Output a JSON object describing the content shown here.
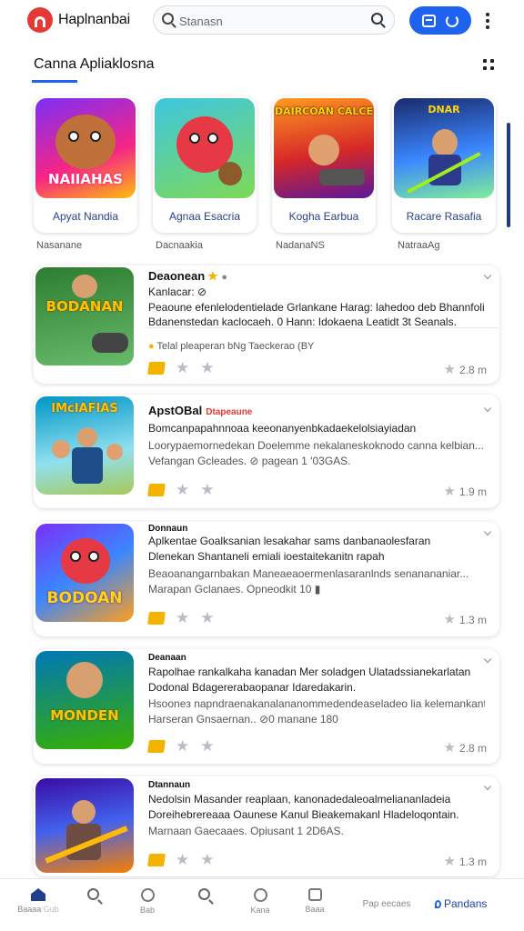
{
  "header": {
    "app_name": "Haplnanbai",
    "search_placeholder": "Stanasn"
  },
  "section": {
    "title": "Canna Apliaklosna"
  },
  "featured": [
    {
      "title": "Apyat Nandia",
      "subtitle": "Nasanane",
      "art_label": "NAIIAHAS"
    },
    {
      "title": "Agnaa Esacria",
      "subtitle": "Dacnaakia",
      "art_label": ""
    },
    {
      "title": "Kogha Earbua",
      "subtitle": "NadanaNS",
      "art_label": "DAIRCOAN CALCE"
    },
    {
      "title": "Racare Rasafia",
      "subtitle": "NatraaAg",
      "art_label": "DNAR"
    }
  ],
  "list": [
    {
      "title": "Deaonean",
      "badge": "",
      "lines": [
        "Kanlacar: ⊘",
        "Peaoune efenlelodentielade Grlankane Harag: lahedoo deb Bhannfolican",
        "Bdanenstedan kaclocaeh. 0 Hann: Idokaena Leatidt 3t Seanals."
      ],
      "note": "Telal pleaperan bNg Taeckerao (BY",
      "rating": "2.8 m",
      "art_label": "BODANAN"
    },
    {
      "title": "ApstOBal",
      "badge": "Dtapeaune",
      "lines": [
        "Bomcanpapahnnoaa keeonanyenbkadaekelolsiayiadan",
        "Loorypaemornedekan Doelemme nekalaneskoknodo canna kelbian...",
        "Vefangan Gcleades.   ⊘ pagean 1 '03GAS."
      ],
      "note": "",
      "rating": "1.9 m",
      "art_label": "IMcIAFIAS"
    },
    {
      "title": "Donnaun",
      "badge": "",
      "lines": [
        "Aplkentae Goalksanian lesakahar sams danbanaolesfaran",
        "Dlenekan Shantaneli emiali ioestaitekanitn rapah",
        "Beaoanangarnbakan Maneaeaoermenlasaranlnds senanananiar...",
        "Marapan Gclanaes.   Opneodkit 10 ▮"
      ],
      "note": "",
      "rating": "1.3 m",
      "art_label": "BODOAN"
    },
    {
      "title": "Deanaan",
      "badge": "",
      "lines": [
        "Rapolhae rankalkaha kanadan Mer soladgen Ulatadssianekarlatan",
        "Dodonal Bdagererabaopanar Idaredakarin.",
        "Hsooneз napndraenakanalananommedendeaseladeo lia kelemankantatia",
        "Harseran Gnsaernan..   ⊘0 manane 180"
      ],
      "note": "",
      "rating": "2.8 m",
      "art_label": "MONDEN"
    },
    {
      "title": "Dtannaun",
      "badge": "",
      "lines": [
        "Nedolsin Masander reaplaan, kanonadedaleoalmeliananladeia",
        "Doreihebrereaaa Oaunese Kanul Bieakemakanl Hladeloqontain.",
        "Marnaan Gaecaaes.   Opiusant 1 2D6AS."
      ],
      "note": "",
      "rating": "1.3 m",
      "art_label": ""
    }
  ],
  "bottom_nav": [
    {
      "label": "Baaaa",
      "extra": "Gub"
    },
    {
      "label": ""
    },
    {
      "label": "Bab"
    },
    {
      "label": ""
    },
    {
      "label": "Kana"
    },
    {
      "label": "Baaa"
    },
    {
      "label": "Pap eecaes"
    },
    {
      "label": "Pandans"
    }
  ],
  "colors": {
    "accent": "#1e63f0",
    "logo": "#e53935",
    "star": "#f5b301"
  }
}
